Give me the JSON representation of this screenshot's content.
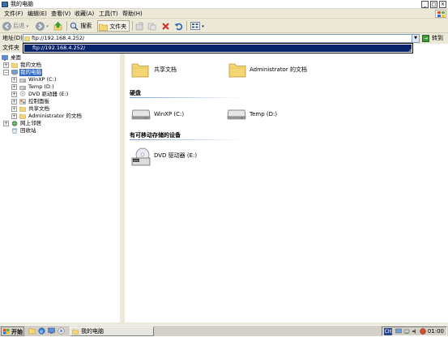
{
  "window": {
    "title": "我的电脑",
    "caption_buttons": [
      "_",
      "□",
      "×"
    ]
  },
  "menubar": {
    "items": [
      "文件(F)",
      "编辑(E)",
      "查看(V)",
      "收藏(A)",
      "工具(T)",
      "帮助(H)"
    ]
  },
  "toolbar": {
    "back_label": "后退",
    "search_label": "搜索",
    "folders_label": "文件夹"
  },
  "address": {
    "label": "地址(D)",
    "value": "ftp://192.168.4.252/",
    "go_label": "转到",
    "suggestion": "ftp://192.168.4.252/"
  },
  "folders_pane": {
    "header": "文件夹",
    "close": "×",
    "tree": [
      {
        "label": "桌面",
        "icon": "desktop-icon"
      },
      {
        "label": "我的文档",
        "icon": "folder-icon"
      },
      {
        "label": "我的电脑",
        "icon": "computer-icon",
        "selected": true
      },
      {
        "label": "WinXP (C:)",
        "icon": "drive-icon"
      },
      {
        "label": "Temp (D:)",
        "icon": "drive-icon"
      },
      {
        "label": "DVD 驱动器 (E:)",
        "icon": "dvd-icon"
      },
      {
        "label": "控制面板",
        "icon": "control-panel-icon"
      },
      {
        "label": "共享文档",
        "icon": "folder-icon"
      },
      {
        "label": "Administrator 的文档",
        "icon": "folder-icon"
      },
      {
        "label": "网上邻居",
        "icon": "network-icon"
      },
      {
        "label": "回收站",
        "icon": "recycle-bin-icon"
      }
    ]
  },
  "content": {
    "folders": [
      "共享文档",
      "Administrator 的文档"
    ],
    "hard_disks_header": "硬盘",
    "hard_disks": [
      "WinXP (C:)",
      "Temp (D:)"
    ],
    "removable_header": "有可移动存储的设备",
    "removable": [
      "DVD 驱动器 (E:)"
    ]
  },
  "taskbar": {
    "start_label": "开始",
    "task_label": "我的电脑",
    "ime": "CH",
    "clock": "01:00"
  },
  "colors": {
    "selection": "#316ac5",
    "folder": "#f4d774",
    "chrome": "#ece9d8"
  }
}
